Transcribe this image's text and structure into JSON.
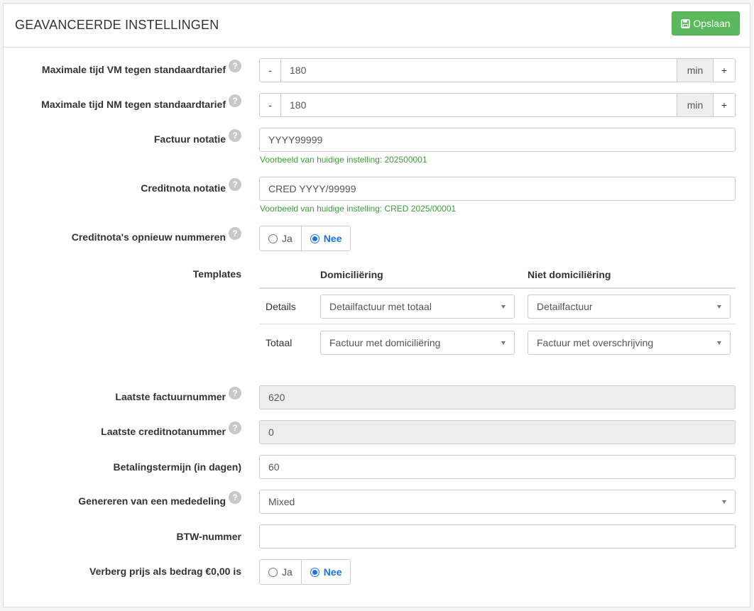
{
  "header": {
    "title": "GEAVANCEERDE INSTELLINGEN",
    "save_label": "Opslaan"
  },
  "help_glyph": "?",
  "max_vm": {
    "label": "Maximale tijd VM tegen standaardtarief",
    "minus": "-",
    "value": "180",
    "unit": "min",
    "plus": "+"
  },
  "max_nm": {
    "label": "Maximale tijd NM tegen standaardtarief",
    "minus": "-",
    "value": "180",
    "unit": "min",
    "plus": "+"
  },
  "invoice_format": {
    "label": "Factuur notatie",
    "value": "YYYY99999",
    "hint": "Voorbeeld van huidige instelling: 202500001"
  },
  "credit_format": {
    "label": "Creditnota notatie",
    "value": "CRED YYYY/99999",
    "hint": "Voorbeeld van huidige instelling: CRED 2025/00001"
  },
  "credit_renumber": {
    "label": "Creditnota's opnieuw nummeren",
    "yes": "Ja",
    "no": "Nee",
    "selected": "Nee"
  },
  "templates": {
    "label": "Templates",
    "col_dom": "Domiciliëring",
    "col_nondom": "Niet domiciliëring",
    "rows": [
      {
        "label": "Details",
        "dom": "Detailfactuur met totaal",
        "nondom": "Detailfactuur"
      },
      {
        "label": "Totaal",
        "dom": "Factuur met domiciliëring",
        "nondom": "Factuur met overschrijving"
      }
    ]
  },
  "last_invoice": {
    "label": "Laatste factuurnummer",
    "value": "620"
  },
  "last_credit": {
    "label": "Laatste creditnotanummer",
    "value": "0"
  },
  "payment_term": {
    "label": "Betalingstermijn (in dagen)",
    "value": "60"
  },
  "message_gen": {
    "label": "Genereren van een mededeling",
    "value": "Mixed"
  },
  "vat": {
    "label": "BTW-nummer",
    "value": ""
  },
  "hide_price": {
    "label": "Verberg prijs als bedrag €0,00 is",
    "yes": "Ja",
    "no": "Nee",
    "selected": "Nee"
  },
  "colors": {
    "save_button": "#5cb85c",
    "hint": "#3c9b3c",
    "radio_active": "#1a73e8"
  }
}
